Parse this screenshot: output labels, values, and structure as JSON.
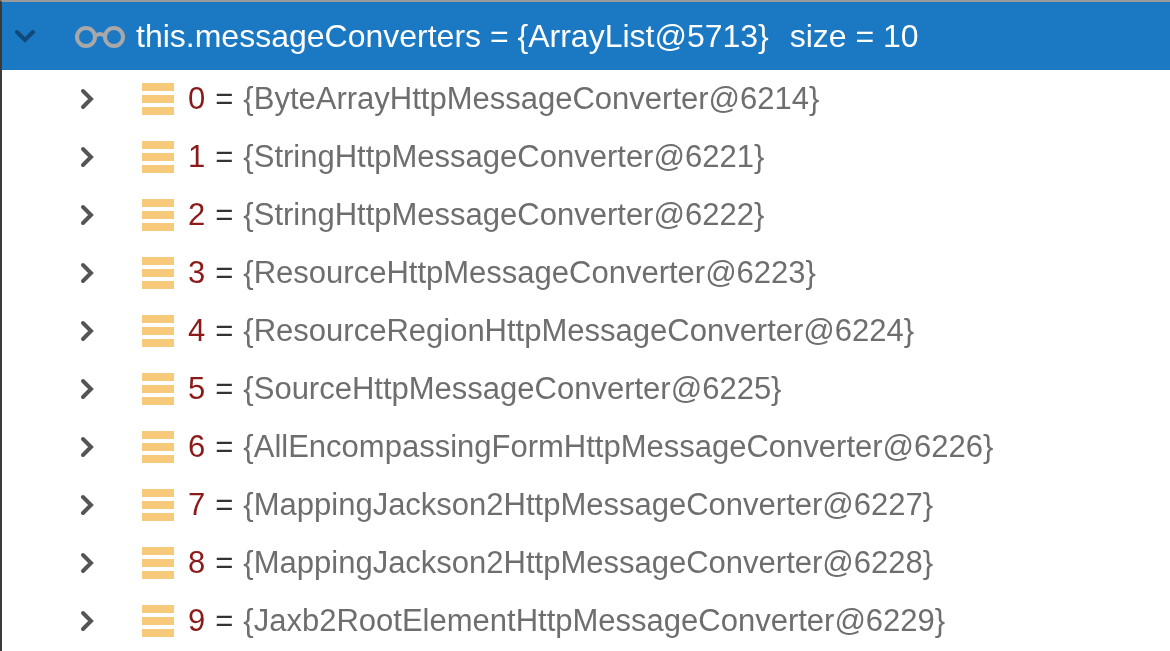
{
  "variable": {
    "name": "this.messageConverters",
    "separator": "=",
    "value": "{ArrayList@5713}",
    "size": "size = 10",
    "expanded": true,
    "selected": true,
    "children": [
      {
        "name": "0",
        "separator": "=",
        "value": "{ByteArrayHttpMessageConverter@6214}",
        "expanded": false
      },
      {
        "name": "1",
        "separator": "=",
        "value": "{StringHttpMessageConverter@6221}",
        "expanded": false
      },
      {
        "name": "2",
        "separator": "=",
        "value": "{StringHttpMessageConverter@6222}",
        "expanded": false
      },
      {
        "name": "3",
        "separator": "=",
        "value": "{ResourceHttpMessageConverter@6223}",
        "expanded": false
      },
      {
        "name": "4",
        "separator": "=",
        "value": "{ResourceRegionHttpMessageConverter@6224}",
        "expanded": false
      },
      {
        "name": "5",
        "separator": "=",
        "value": "{SourceHttpMessageConverter@6225}",
        "expanded": false
      },
      {
        "name": "6",
        "separator": "=",
        "value": "{AllEncompassingFormHttpMessageConverter@6226}",
        "expanded": false
      },
      {
        "name": "7",
        "separator": "=",
        "value": "{MappingJackson2HttpMessageConverter@6227}",
        "expanded": false
      },
      {
        "name": "8",
        "separator": "=",
        "value": "{MappingJackson2HttpMessageConverter@6228}",
        "expanded": false
      },
      {
        "name": "9",
        "separator": "=",
        "value": "{Jaxb2RootElementHttpMessageConverter@6229}",
        "expanded": false
      }
    ]
  }
}
